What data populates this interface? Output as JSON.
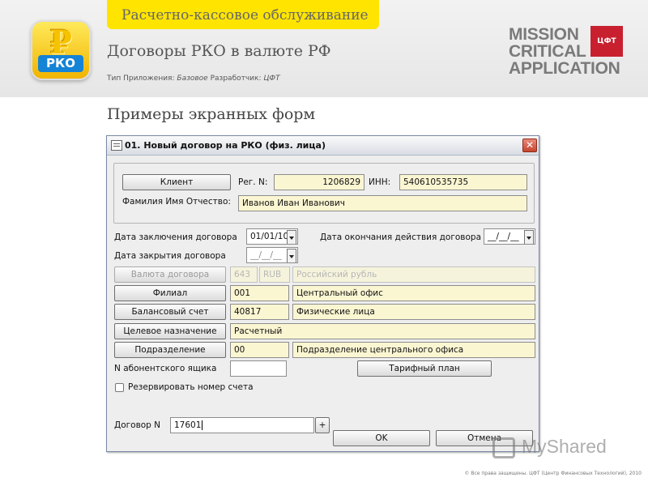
{
  "header": {
    "tab_title": "Расчетно-кассовое обслуживание",
    "page_title": "Договоры РКО в валюте РФ",
    "meta": {
      "type_label": "Тип Приложения:",
      "type_value": "Базовое",
      "dev_label": "Разработчик:",
      "dev_value": "ЦФТ"
    },
    "app_logo": {
      "glyph": "₽",
      "badge": "РКО"
    },
    "brand": {
      "line1": "MISSION",
      "line2": "CRITICAL",
      "line3": "APPLICATION",
      "mark": "ЦФТ"
    }
  },
  "section_title": "Примеры экранных форм",
  "window": {
    "title": "01. Новый договор на РКО (физ. лица)",
    "close_glyph": "✕",
    "client": {
      "button": "Клиент",
      "reg_label": "Рег. N:",
      "reg_value": "1206829",
      "inn_label": "ИНН:",
      "inn_value": "540610535735",
      "fio_label": "Фамилия Имя Отчество:",
      "fio_value": "Иванов Иван Иванович"
    },
    "dates": {
      "conclusion_label": "Дата заключения договора",
      "conclusion_value": "01/01/10",
      "end_label": "Дата окончания действия договора",
      "end_value": "__/__/__",
      "close_label": "Дата закрытия договора",
      "close_value": "__/__/__"
    },
    "rows": [
      {
        "button": "Валюта договора",
        "code": "643",
        "code2": "RUB",
        "value": "Российский рубль"
      },
      {
        "button": "Филиал",
        "code": "001",
        "value": "Центральный офис"
      },
      {
        "button": "Балансовый счет",
        "code": "40817",
        "value": "Физические лица"
      },
      {
        "button": "Целевое назначение",
        "value": "Расчетный"
      },
      {
        "button": "Подразделение",
        "code": "00",
        "value": "Подразделение центрального офиса"
      }
    ],
    "mailbox_label": "N абонентского ящика",
    "mailbox_value": "",
    "tariff_button": "Тарифный план",
    "reserve_label": "Резервировать номер счета",
    "contract_label": "Договор N",
    "contract_value": "17601",
    "plus_button": "+",
    "ok_button": "OK",
    "cancel_button": "Отмена"
  },
  "watermark": "MyShared",
  "footer": "© Все права защищены. ЦФТ (Центр Финансовых Технологий), 2010"
}
